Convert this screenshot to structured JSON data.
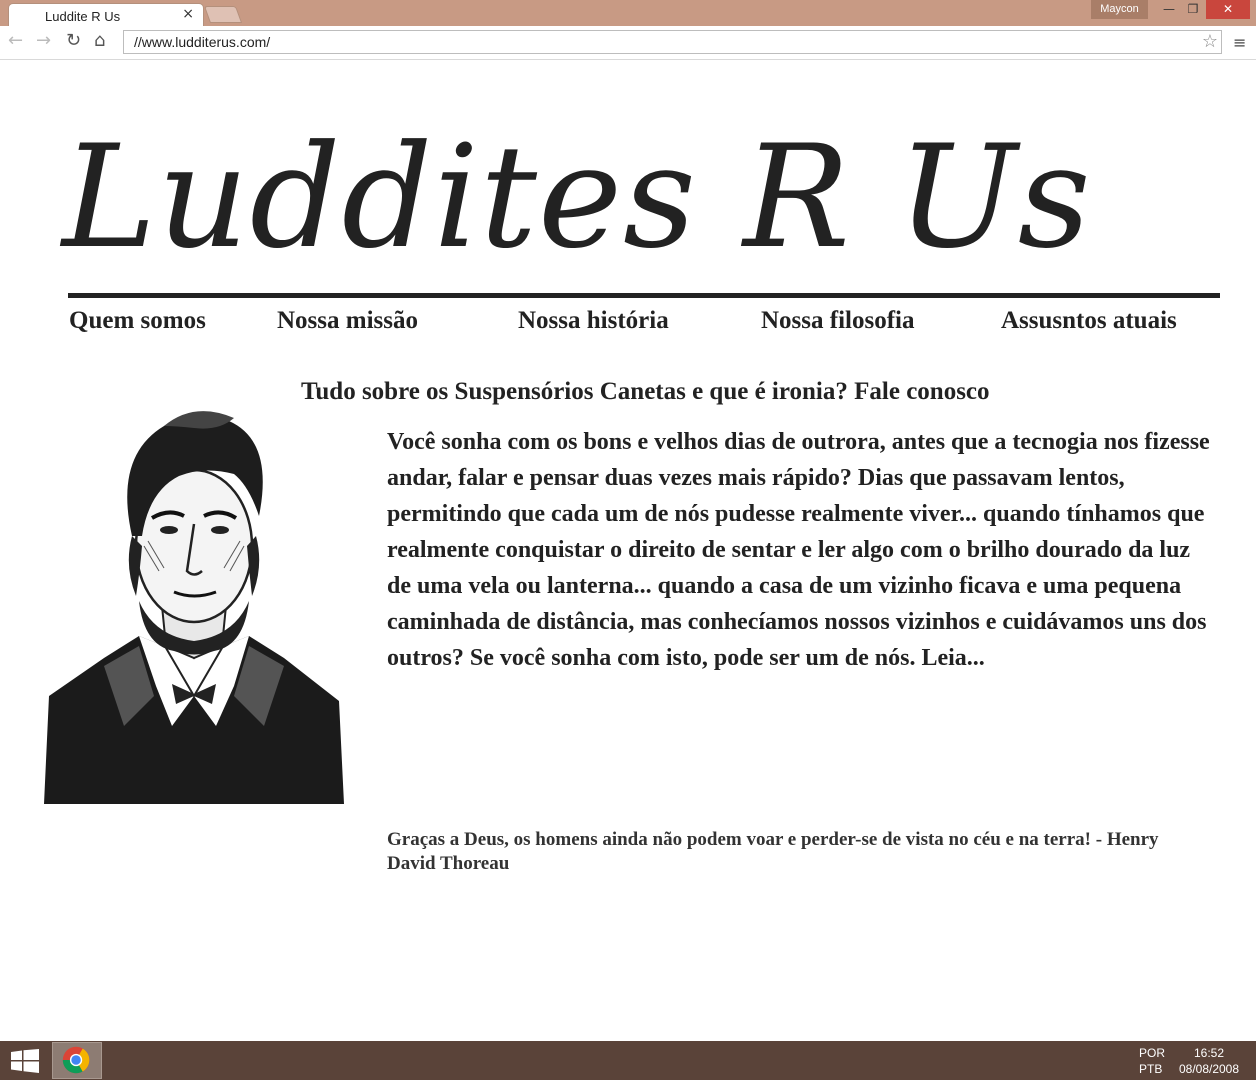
{
  "browser": {
    "tab_title": "Luddite R Us",
    "tab_close": "×",
    "user": "Maycon",
    "url": "//www.ludditerus.com/",
    "window_controls": {
      "minimize": "—",
      "maximize": "❐",
      "close": "✕"
    },
    "nav": {
      "back": "←",
      "forward": "→",
      "reload": "↻",
      "home": "⌂",
      "star": "☆",
      "menu": "≡"
    }
  },
  "site": {
    "logo": "Luddites R Us",
    "nav": [
      "Quem somos",
      "Nossa missão",
      "Nossa história",
      "Nossa filosofia",
      "Assusntos atuais"
    ],
    "headline": "Tudo sobre os Suspensórios Canetas e que é ironia? Fale conosco",
    "body": "Você sonha com os bons e velhos dias de outrora, antes que a tecnogia nos fizesse andar, falar e pensar duas vezes mais rápido? Dias que passavam lentos, permitindo que cada um de nós pudesse realmente viver... quando tínhamos que realmente conquistar o direito de sentar e ler algo com o brilho dourado da luz de uma vela ou lanterna... quando a casa de um vizinho ficava e uma pequena caminhada de distância, mas conhecíamos nossos vizinhos e cuidávamos uns dos outros? Se você sonha com isto, pode ser um de nós. Leia...",
    "quote": "Graças a Deus, os homens ainda não podem voar e perder-se de vista no céu e na terra! - Henry David Thoreau"
  },
  "taskbar": {
    "lang_top": "POR",
    "lang_bottom": "PTB",
    "time": "16:52",
    "date": "08/08/2008"
  }
}
